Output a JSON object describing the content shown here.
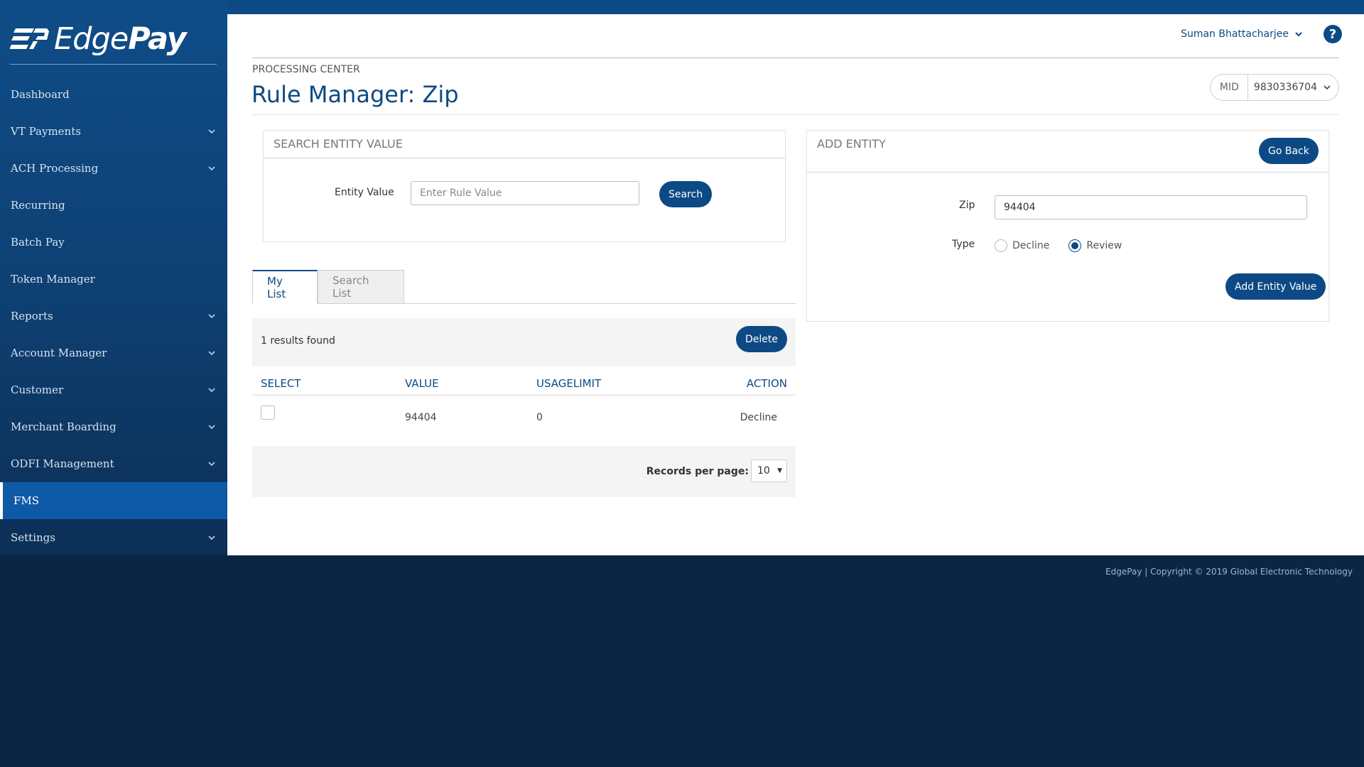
{
  "brand": {
    "logo_text_edge": "Edge",
    "logo_text_pay": "Pay"
  },
  "sidebar": {
    "items": [
      {
        "label": "Dashboard",
        "has_submenu": false
      },
      {
        "label": "VT Payments",
        "has_submenu": true
      },
      {
        "label": "ACH Processing",
        "has_submenu": true
      },
      {
        "label": "Recurring",
        "has_submenu": false
      },
      {
        "label": "Batch Pay",
        "has_submenu": false
      },
      {
        "label": "Token Manager",
        "has_submenu": false
      },
      {
        "label": "Reports",
        "has_submenu": true
      },
      {
        "label": "Account Manager",
        "has_submenu": true
      },
      {
        "label": "Customer",
        "has_submenu": true
      },
      {
        "label": "Merchant Boarding",
        "has_submenu": true
      },
      {
        "label": "ODFI Management",
        "has_submenu": true
      },
      {
        "label": "FMS",
        "has_submenu": false,
        "active": true
      },
      {
        "label": "Settings",
        "has_submenu": true
      }
    ]
  },
  "header": {
    "user_name": "Suman Bhattacharjee",
    "help_icon": "question-circle-icon"
  },
  "page": {
    "breadcrumb": "PROCESSING CENTER",
    "title": "Rule Manager: Zip",
    "mid_label": "MID",
    "mid_value": "9830336704"
  },
  "search_panel": {
    "heading": "SEARCH ENTITY VALUE",
    "field_label": "Entity Value",
    "placeholder": "Enter Rule Value",
    "value": "",
    "button_label": "Search"
  },
  "add_panel": {
    "heading": "ADD ENTITY",
    "go_back_label": "Go Back",
    "zip_label": "Zip",
    "zip_value": "94404",
    "type_label": "Type",
    "type_options": [
      "Decline",
      "Review"
    ],
    "type_selected": "Review",
    "add_button_label": "Add Entity Value"
  },
  "tabs": [
    {
      "label": "My List",
      "active": true
    },
    {
      "label": "Search List",
      "active": false
    }
  ],
  "results": {
    "count_text": "1 results found",
    "delete_label": "Delete",
    "columns": [
      "SELECT",
      "VALUE",
      "USAGELIMIT",
      "ACTION"
    ],
    "rows": [
      {
        "value": "94404",
        "usage_limit": "0",
        "action": "Decline"
      }
    ],
    "records_per_page_label": "Records per page:",
    "records_per_page": "10"
  },
  "footer": {
    "text": "EdgePay | Copyright © 2019 Global Electronic Technology"
  },
  "colors": {
    "primary": "#0d4a85",
    "sidebar": "#0f4d88",
    "background": "#0b2645"
  }
}
